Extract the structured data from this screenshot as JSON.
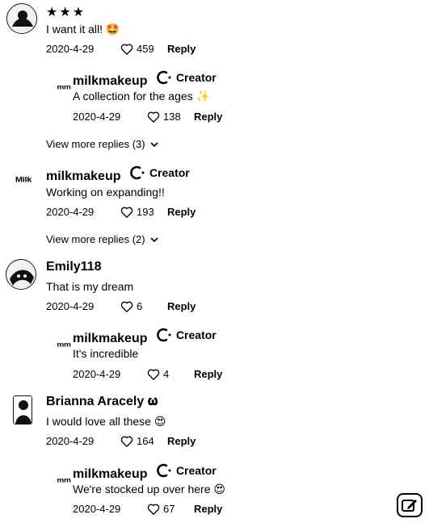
{
  "comments": [
    {
      "user": "★★★",
      "text": "I want it all! 🤩",
      "date": "2020-4-29",
      "likes": "459",
      "reply": "Reply"
    },
    {
      "user": "milkmakeup",
      "creator": "Creator",
      "text": "A collection for the ages ✨",
      "date": "2020-4-29",
      "likes": "138",
      "reply": "Reply"
    },
    {
      "more": "View more replies (3)"
    },
    {
      "user": "milkmakeup",
      "creator": "Creator",
      "avatar_text": "Milk",
      "text": "Working on expanding!!",
      "date": "2020-4-29",
      "likes": "193",
      "reply": "Reply"
    },
    {
      "more": "View more replies (2)"
    },
    {
      "user": "Emily118",
      "text": "That is my dream",
      "date": "2020-4-29",
      "likes": "6",
      "reply": "Reply"
    },
    {
      "user": "milkmakeup",
      "creator": "Creator",
      "text": "It's incredible",
      "date": "2020-4-29",
      "likes": "4",
      "reply": "Reply"
    },
    {
      "user": "Brianna Aracely 𝛚",
      "text": "I would love all these 😍",
      "date": "2020-4-29",
      "likes": "164",
      "reply": "Reply"
    },
    {
      "user": "milkmakeup",
      "creator": "Creator",
      "text": "We're stocked up over here 😍",
      "date": "2020-4-29",
      "likes": "67",
      "reply": "Reply"
    }
  ],
  "icons": {
    "like": "heart-outline-icon",
    "creator": "creator-badge-icon",
    "chevron": "chevron-down-icon",
    "compose": "compose-icon"
  }
}
